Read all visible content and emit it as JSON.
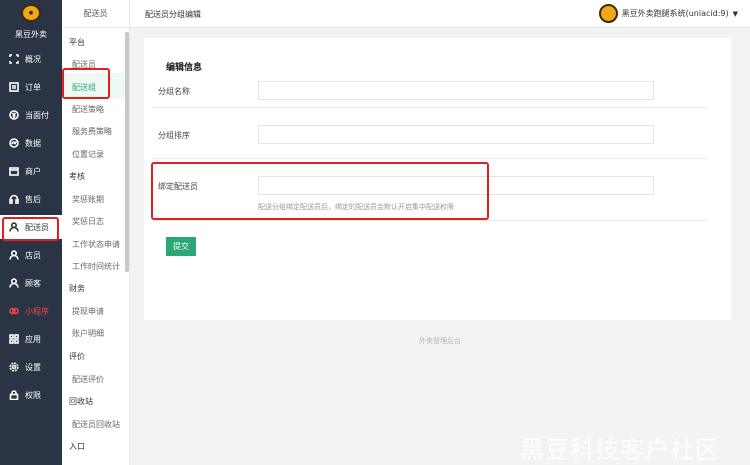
{
  "brand": {
    "name": "黑豆外卖"
  },
  "main_nav": [
    {
      "label": "概况",
      "icon": "frame-icon"
    },
    {
      "label": "订单",
      "icon": "list-icon"
    },
    {
      "label": "当面付",
      "icon": "yen-icon"
    },
    {
      "label": "数据",
      "icon": "chart-icon"
    },
    {
      "label": "商户",
      "icon": "store-icon"
    },
    {
      "label": "售后",
      "icon": "headset-icon"
    },
    {
      "label": "配送员",
      "icon": "user-icon"
    },
    {
      "label": "店员",
      "icon": "user-icon"
    },
    {
      "label": "顾客",
      "icon": "user-icon"
    },
    {
      "label": "小程序",
      "icon": "miniapp-icon"
    },
    {
      "label": "应用",
      "icon": "grid-icon"
    },
    {
      "label": "设置",
      "icon": "gear-icon"
    },
    {
      "label": "权限",
      "icon": "lock-icon"
    }
  ],
  "sub_nav": {
    "header": "配送员",
    "groups": [
      {
        "label": "平台"
      },
      {
        "label": "考核"
      },
      {
        "label": "财务"
      },
      {
        "label": "评价"
      },
      {
        "label": "回收站"
      },
      {
        "label": "入口"
      }
    ],
    "items": [
      {
        "label": "配送员"
      },
      {
        "label": "配送组"
      },
      {
        "label": "配送策略"
      },
      {
        "label": "服务费策略"
      },
      {
        "label": "位置记录"
      },
      {
        "label": "奖惩账期"
      },
      {
        "label": "奖惩日志"
      },
      {
        "label": "工作状态申请"
      },
      {
        "label": "工作时间统计"
      },
      {
        "label": "提现申请"
      },
      {
        "label": "账户明细"
      },
      {
        "label": "配送评价"
      },
      {
        "label": "配送员回收站"
      }
    ]
  },
  "header": {
    "title": "配送员分组编辑",
    "user": "黑豆外卖跑腿系统(uniacid:9)",
    "caret": "▼"
  },
  "form": {
    "section_title": "编辑信息",
    "fields": [
      {
        "label": "分组名称",
        "value": ""
      },
      {
        "label": "分组排序",
        "value": ""
      },
      {
        "label": "绑定配送员",
        "value": ""
      }
    ],
    "hint": "配送分组绑定配送员后，绑定的配送员会默认开启集中配送权限",
    "submit_label": "提交"
  },
  "footer": "外卖管理后台",
  "watermark": "黑豆科技客户社区",
  "colors": {
    "accent": "#2aa774",
    "sidebar": "#2b3444",
    "highlight": "#e02020"
  }
}
